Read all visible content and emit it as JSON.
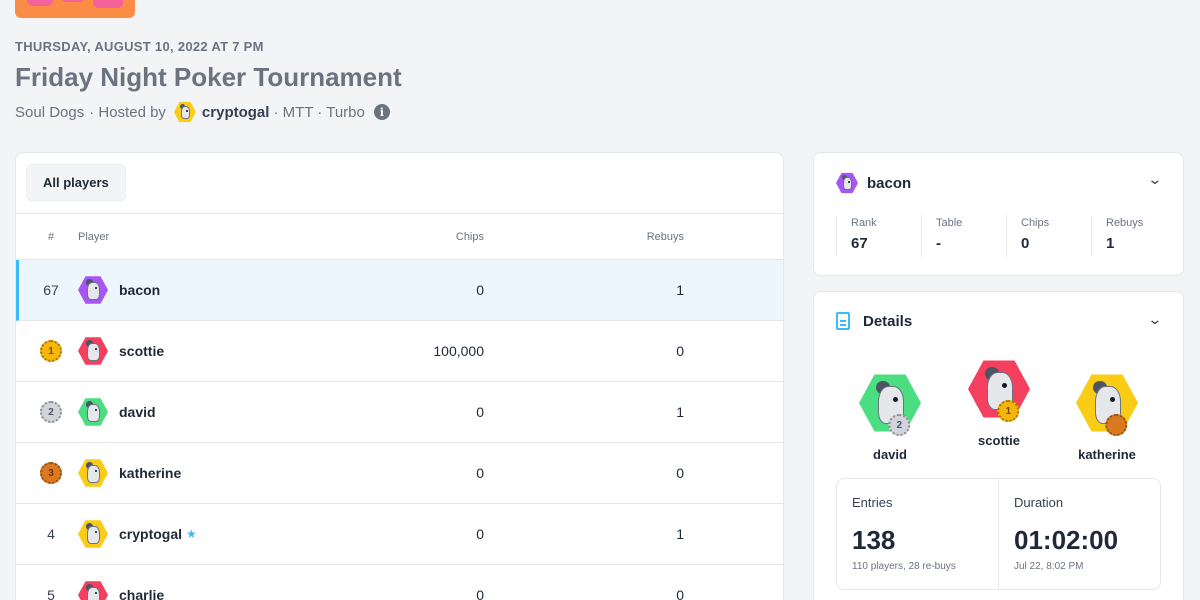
{
  "event": {
    "date": "THURSDAY, AUGUST 10, 2022 AT 7 PM",
    "title": "Friday Night Poker Tournament",
    "org": "Soul Dogs",
    "hosted_by_label": "· Hosted by",
    "host": "cryptogal",
    "format": "· MTT · Turbo",
    "info_icon": "i"
  },
  "players_tab": {
    "label": "All players"
  },
  "table": {
    "headers": {
      "rank": "#",
      "player": "Player",
      "chips": "Chips",
      "rebuys": "Rebuys"
    },
    "rows": [
      {
        "rank": "67",
        "name": "bacon",
        "chips": "0",
        "rebuys": "1"
      },
      {
        "medal": "1",
        "name": "scottie",
        "chips": "100,000",
        "rebuys": "0"
      },
      {
        "medal": "2",
        "name": "david",
        "chips": "0",
        "rebuys": "1"
      },
      {
        "medal": "3",
        "name": "katherine",
        "chips": "0",
        "rebuys": "0"
      },
      {
        "rank": "4",
        "name": "cryptogal",
        "star": "★",
        "chips": "0",
        "rebuys": "1"
      },
      {
        "rank": "5",
        "name": "charlie",
        "chips": "0",
        "rebuys": "0"
      }
    ]
  },
  "selected_player": {
    "name": "bacon",
    "chevron": "⌄",
    "stats": [
      {
        "label": "Rank",
        "value": "67"
      },
      {
        "label": "Table",
        "value": "-"
      },
      {
        "label": "Chips",
        "value": "0"
      },
      {
        "label": "Rebuys",
        "value": "1"
      }
    ]
  },
  "details": {
    "title": "Details",
    "chevron": "⌄",
    "podium": [
      {
        "name": "david",
        "medal": "2"
      },
      {
        "name": "scottie",
        "medal": "1"
      },
      {
        "name": "katherine",
        "medal": ""
      }
    ],
    "entries": {
      "label": "Entries",
      "value": "138",
      "sub": "110 players, 28 re-buys"
    },
    "duration": {
      "label": "Duration",
      "value": "01:02:00",
      "sub": "Jul 22, 8:02 PM"
    }
  },
  "colors": {
    "accent": "#38bdf8",
    "avatar_purple": "#a855f7",
    "avatar_red": "#f43f5e",
    "avatar_green": "#4ade80",
    "avatar_yellow": "#facc15",
    "medal_gold": "#f5b50a",
    "medal_silver": "#d1d5db",
    "medal_bronze": "#d97a20"
  }
}
